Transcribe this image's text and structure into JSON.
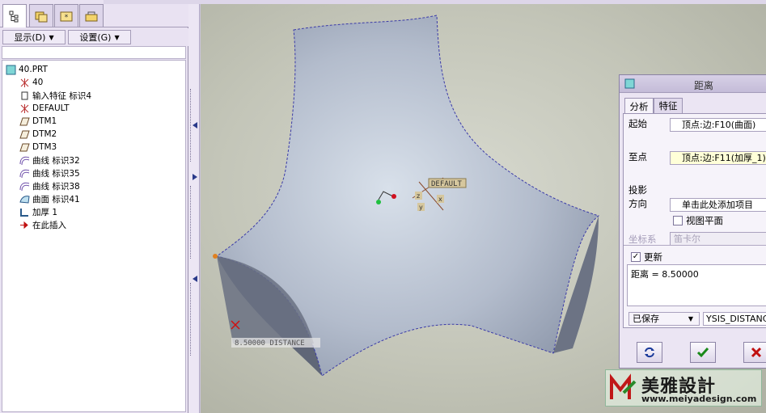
{
  "left_panel": {
    "menus": {
      "show": "显示(D)",
      "settings": "设置(G)"
    },
    "tree": [
      {
        "label": "40.PRT",
        "icon": "part-icon"
      },
      {
        "label": "40",
        "icon": "csys-icon"
      },
      {
        "label": "输入特征 标识4",
        "icon": "import-feature-icon"
      },
      {
        "label": "DEFAULT",
        "icon": "csys-icon"
      },
      {
        "label": "DTM1",
        "icon": "datum-plane-icon"
      },
      {
        "label": "DTM2",
        "icon": "datum-plane-icon"
      },
      {
        "label": "DTM3",
        "icon": "datum-plane-icon"
      },
      {
        "label": "曲线 标识32",
        "icon": "curve-icon"
      },
      {
        "label": "曲线 标识35",
        "icon": "curve-icon"
      },
      {
        "label": "曲线 标识38",
        "icon": "curve-icon"
      },
      {
        "label": "曲面 标识41",
        "icon": "surface-icon"
      },
      {
        "label": "加厚 1",
        "icon": "thicken-icon"
      },
      {
        "label": "在此插入",
        "icon": "insert-here-arrow-icon"
      }
    ]
  },
  "viewport": {
    "csys_label": "DEFAULT",
    "axis_x": "x",
    "axis_y": "y",
    "axis_z": "z",
    "distance_annotation": "8.50000  DISTANCE"
  },
  "dialog": {
    "title": "距离",
    "tabs": [
      "分析",
      "特征"
    ],
    "from_label": "起始",
    "from_value": "顶点:边:F10(曲面)",
    "to_label": "至点",
    "to_value": "顶点:边:F11(加厚_1)",
    "projection_label": "投影",
    "direction_label": "方向",
    "direction_value": "单击此处添加项目",
    "view_plane_label": "视图平面",
    "csys_label": "坐标系",
    "csys_value": "笛卡尔",
    "update_label": "更新",
    "result_text": "距离 = 8.50000",
    "saved_value": "已保存",
    "name_value": "YSIS_DISTANCE"
  },
  "logo": {
    "name": "美雅設計",
    "url": "www.meiyadesign.com"
  },
  "colors": {
    "panel": "#e9e2f2",
    "surface": "#b9c0d2",
    "edge": "#3a3aa8",
    "ok_green": "#1a8a1a",
    "cancel_red": "#c01010"
  }
}
